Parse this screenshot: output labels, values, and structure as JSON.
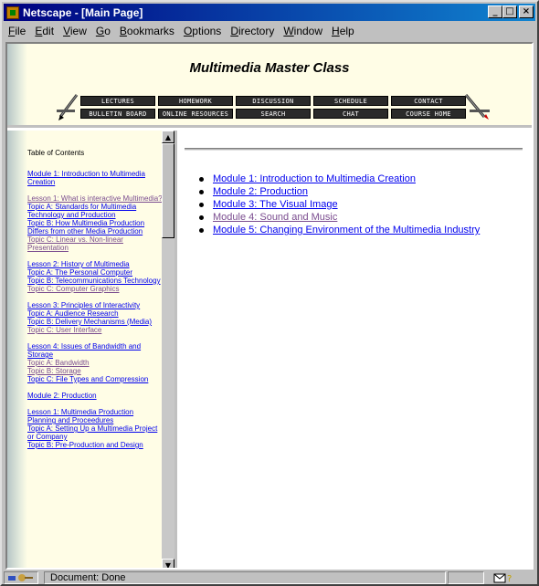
{
  "window": {
    "title": "Netscape - [Main Page]",
    "controls": [
      "minimize-icon",
      "maximize-icon",
      "close-icon"
    ]
  },
  "menu": [
    "File",
    "Edit",
    "View",
    "Go",
    "Bookmarks",
    "Options",
    "Directory",
    "Window",
    "Help"
  ],
  "banner": {
    "title": "Multimedia Master Class",
    "nav_row1": [
      "LECTURES",
      "HOMEWORK",
      "DISCUSSION",
      "SCHEDULE",
      "CONTACT"
    ],
    "nav_row2": [
      "BULLETIN BOARD",
      "ONLINE RESOURCES",
      "SEARCH",
      "CHAT",
      "COURSE HOME"
    ]
  },
  "toc": {
    "title": "Table of Contents",
    "groups": [
      [
        {
          "text": "Module 1: Introduction to Multimedia Creation",
          "visited": false
        }
      ],
      [
        {
          "text": "Lesson 1: What is interactive Multimedia?",
          "visited": true
        },
        {
          "text": "Topic A: Standards for Multimedia Technology and Production",
          "visited": false
        },
        {
          "text": "Topic B: How Multimedia Production Differs from other Media Production",
          "visited": false
        },
        {
          "text": "Topic C: Linear vs. Non-linear Presentation",
          "visited": true
        }
      ],
      [
        {
          "text": "Lesson 2: History of Multimedia",
          "visited": false
        },
        {
          "text": "Topic A: The Personal Computer",
          "visited": false
        },
        {
          "text": "Topic B: Telecommunications Technology",
          "visited": false
        },
        {
          "text": "Topic C: Computer Graphics",
          "visited": true
        }
      ],
      [
        {
          "text": "Lesson 3: Principles of Interactivity",
          "visited": false
        },
        {
          "text": "Topic A: Audience Research",
          "visited": false
        },
        {
          "text": "Topic B: Delivery Mechanisms (Media)",
          "visited": false
        },
        {
          "text": "Topic C: User Interface",
          "visited": true
        }
      ],
      [
        {
          "text": "Lesson 4: Issues of Bandwidth and Storage",
          "visited": false
        },
        {
          "text": "Topic A: Bandwidth",
          "visited": true
        },
        {
          "text": "Topic B: Storage",
          "visited": true
        },
        {
          "text": "Topic C: File Types and Compression",
          "visited": false
        }
      ],
      [
        {
          "text": "Module 2: Production",
          "visited": false
        }
      ],
      [
        {
          "text": "Lesson 1: Multimedia Production Planning and Proceedures",
          "visited": false
        },
        {
          "text": "Topic A: Setting Up a Multimedia Project or Company",
          "visited": false
        },
        {
          "text": "Topic B: Pre-Production and Design",
          "visited": false
        }
      ]
    ]
  },
  "modules": [
    {
      "text": "Module 1: Introduction to Multimedia Creation",
      "visited": false
    },
    {
      "text": "Module 2: Production",
      "visited": false
    },
    {
      "text": "Module 3: The Visual Image",
      "visited": false
    },
    {
      "text": "Module 4: Sound and Music",
      "visited": true
    },
    {
      "text": "Module 5: Changing Environment of the Multimedia Industry",
      "visited": false
    }
  ],
  "status": {
    "message": "Document: Done"
  },
  "colors": {
    "link": "#0000ee",
    "visited": "#7a4c8f",
    "frame_bg": "#fffde6",
    "title_bar": "#000080"
  }
}
